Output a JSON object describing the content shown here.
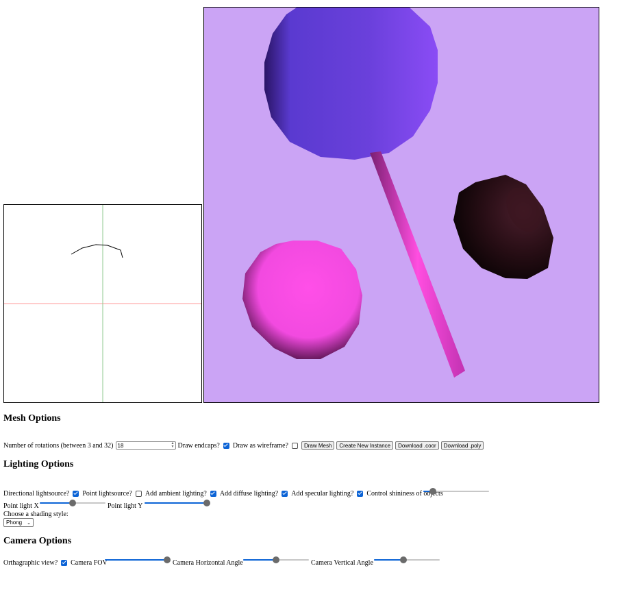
{
  "mesh": {
    "heading": "Mesh Options",
    "rotations_label": "Number of rotations (between 3 and 32)",
    "rotations_value": "18",
    "endcaps_label": "Draw endcaps?",
    "endcaps_checked": true,
    "wireframe_label": "Draw as wireframe?",
    "wireframe_checked": false,
    "buttons": {
      "draw_mesh": "Draw Mesh",
      "create_instance": "Create New Instance",
      "download_coor": "Download .coor",
      "download_poly": "Download .poly"
    }
  },
  "lighting": {
    "heading": "Lighting Options",
    "directional_label": "Directional lightsource?",
    "directional_checked": true,
    "point_label": "Point lightsource?",
    "point_checked": false,
    "ambient_label": "Add ambient lighting?",
    "ambient_checked": true,
    "diffuse_label": "Add diffuse lighting?",
    "diffuse_checked": true,
    "specular_label": "Add specular lighting?",
    "specular_checked": true,
    "shininess_label": "Control shininess of objects",
    "shininess_level": 0.15,
    "point_x_label": "Point light X",
    "point_x_level": 0.5,
    "point_y_label": "Point light Y",
    "point_y_level": 0.95,
    "shading_label": "Choose a shading style:",
    "shading_value": "Phong"
  },
  "camera": {
    "heading": "Camera Options",
    "ortho_label": "Orthagraphic view?",
    "ortho_checked": true,
    "fov_label": "Camera FOV",
    "fov_level": 0.95,
    "horiz_label": "Camera Horizontal Angle",
    "horiz_level": 0.5,
    "vert_label": "Camera Vertical Angle",
    "vert_level": 0.45
  },
  "colors": {
    "scene_background": "#cba4f5",
    "accent": "#0b63d6",
    "axis_x": "#ff9a9a",
    "axis_y": "#8fc98f"
  }
}
